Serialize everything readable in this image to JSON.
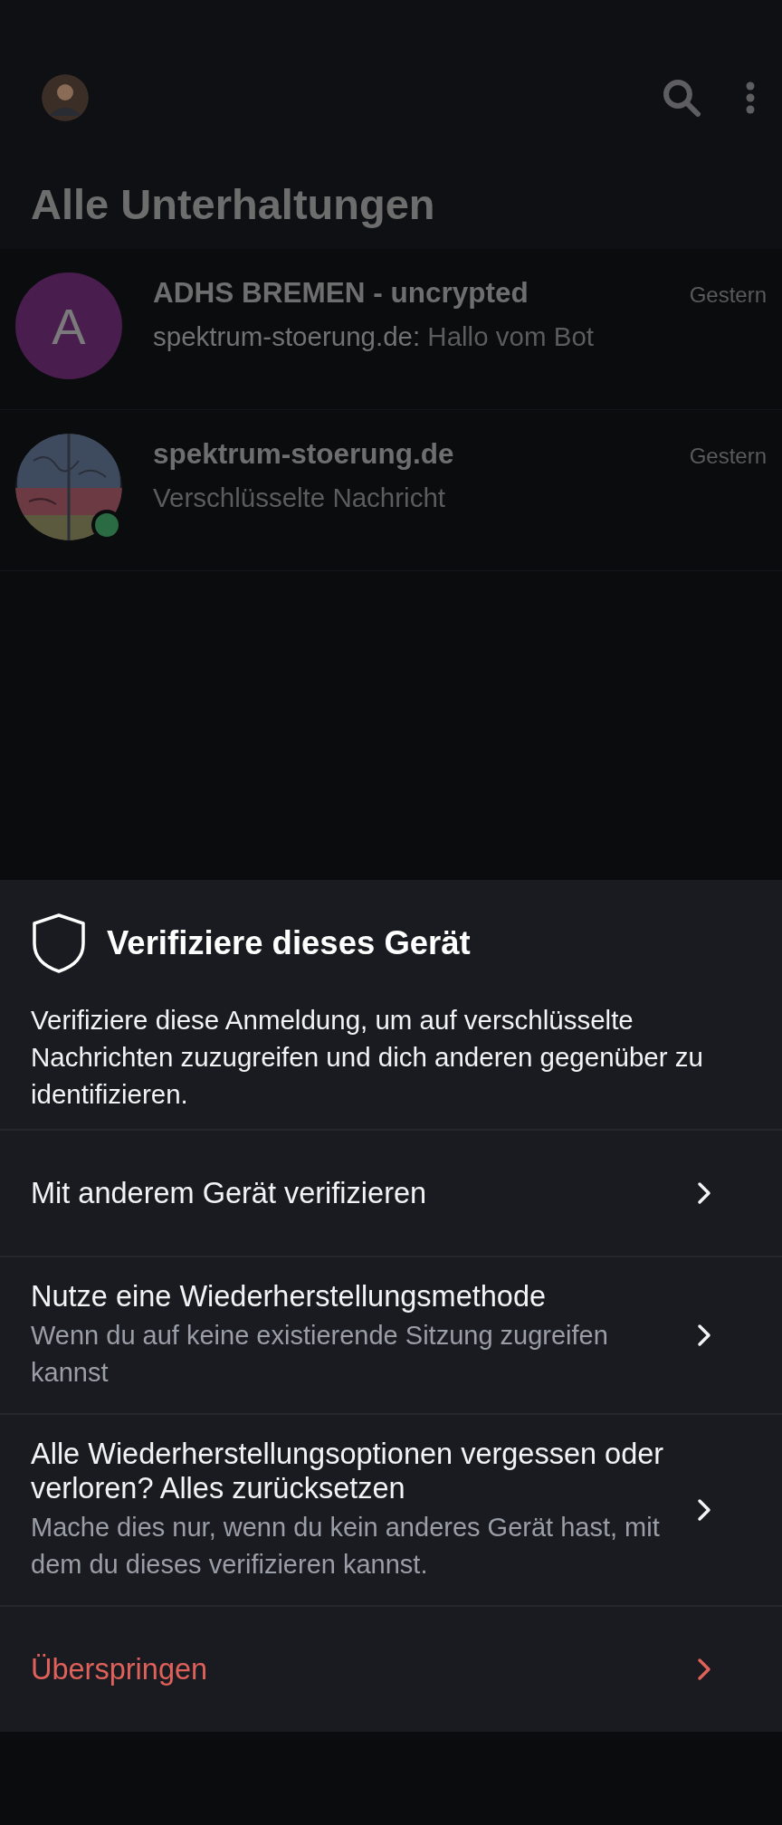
{
  "header": {
    "title": "Alle Unterhaltungen"
  },
  "conversations": [
    {
      "name": "ADHS BREMEN - uncrypted",
      "time": "Gestern",
      "avatar": {
        "kind": "letter",
        "letter": "A",
        "color": "#4a1d4f"
      },
      "sender": "spektrum-stoerung.de:",
      "message": "Hallo vom Bot",
      "online": false
    },
    {
      "name": "spektrum-stoerung.de",
      "time": "Gestern",
      "message": "Verschlüsselte Nachricht",
      "online": true
    }
  ],
  "sheet": {
    "title": "Verifiziere dieses Gerät",
    "description": "Verifiziere diese Anmeldung, um auf verschlüsselte Nachrichten zuzugreifen und dich anderen gegenüber zu identifizieren.",
    "options": [
      {
        "kind": "normal",
        "title": "Mit anderem Gerät verifizieren"
      },
      {
        "kind": "normal",
        "title": "Nutze eine Wiederherstellungsmethode",
        "subtitle": "Wenn du auf keine existierende Sitzung zugreifen kannst"
      },
      {
        "kind": "normal",
        "title": "Alle Wiederherstellungsoptionen vergessen oder verloren? Alles zurücksetzen",
        "subtitle": "Mache dies nur, wenn du kein anderes Gerät hast, mit dem du dieses verifizieren kannst."
      },
      {
        "kind": "danger",
        "title": "Überspringen"
      }
    ]
  }
}
